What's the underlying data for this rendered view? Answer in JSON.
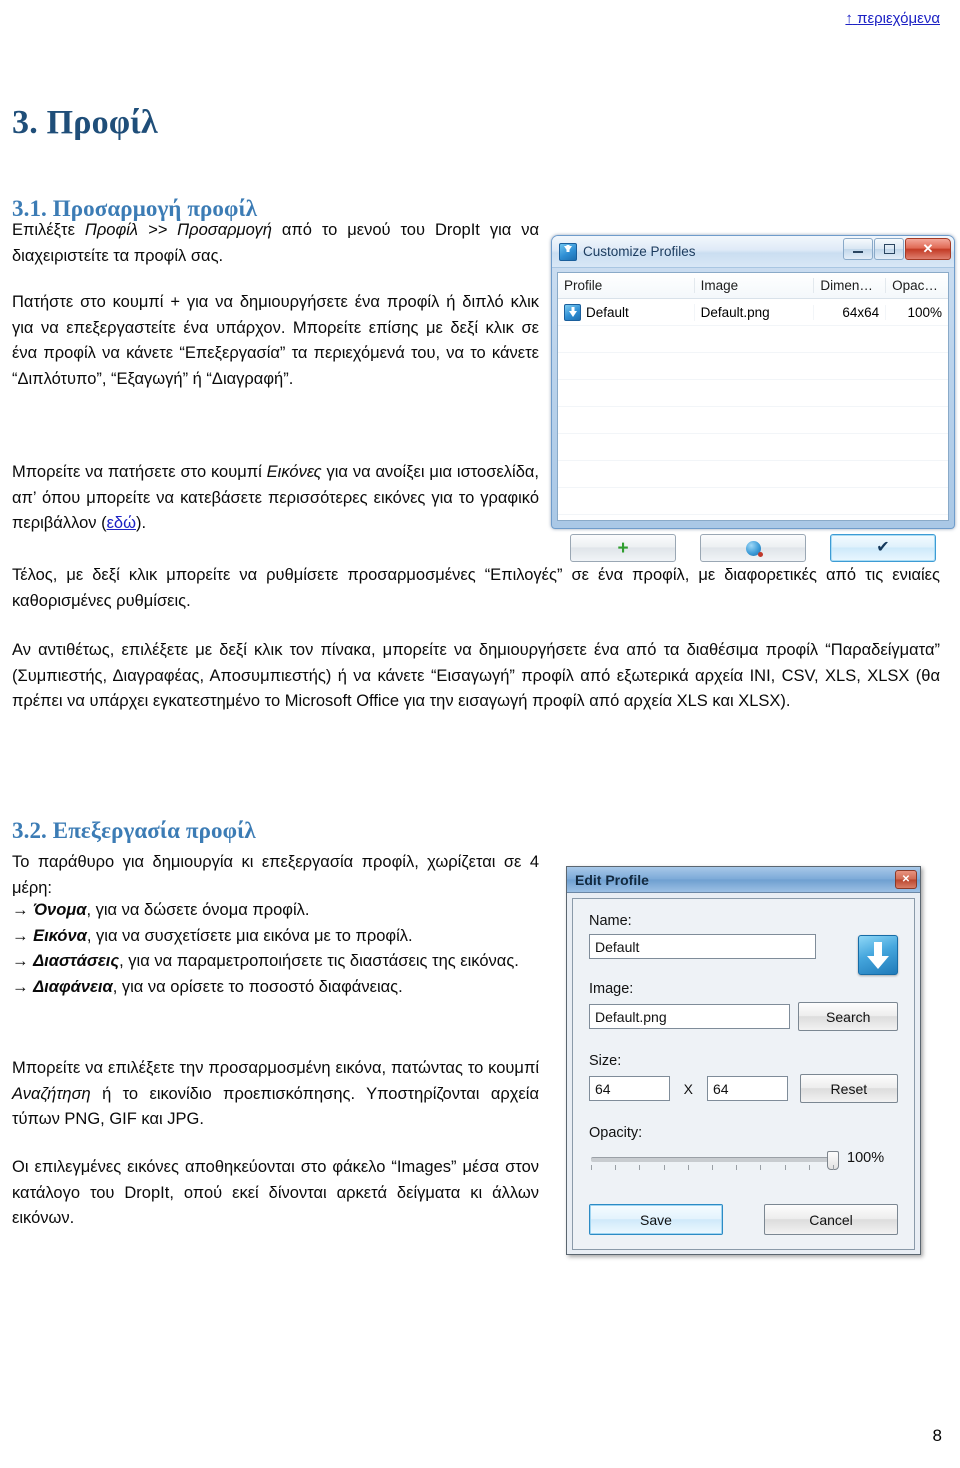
{
  "toc_link": {
    "arrow": "↑",
    "label": "περιεχόμενα"
  },
  "page_number": "8",
  "headings": {
    "h1": "3. Προφίλ",
    "h2_1": "3.1. Προσαρμογή προφίλ",
    "h2_2": "3.2. Επεξεργασία προφίλ"
  },
  "paragraphs": {
    "intro_a": "Επιλέξτε ",
    "intro_em": "Προφίλ >> Προσαρμογή",
    "intro_b": " από το μενού του DropIt για να διαχειριστείτε τα προφίλ σας.",
    "create": "Πατήστε στο κουμπί + για να δημιουργήσετε ένα προφίλ ή διπλό κλικ για να επεξεργαστείτε ένα υπάρχον. Μπορείτε επίσης με δεξί κλικ σε ένα προφίλ να κάνετε “Επεξεργασία” τα περιεχόμενά του, να το κάνετε “Διπλότυπο”, “Εξαγωγή” ή “Διαγραφή”.",
    "images_a": "Μπορείτε να πατήσετε στο κουμπί ",
    "images_em": "Εικόνες",
    "images_b": " για να ανοίξει μια ιστοσελίδα, απ’ όπου μπορείτε να κατεβάσετε περισσότερες εικόνες για το γραφικό περιβάλλον (",
    "images_link": "εδώ",
    "images_c": ").",
    "options": "Τέλος, με δεξί κλικ μπορείτε να ρυθμίσετε προσαρμοσμένες “Επιλογές” σε ένα προφίλ, με διαφορετικές από τις ενιαίες καθορισμένες ρυθμίσεις.",
    "import": "Αν αντιθέτως, επιλέξετε με δεξί κλικ τον πίνακα, μπορείτε να δημιουργήσετε ένα από τα διαθέσιμα προφίλ “Παραδείγματα” (Συμπιεστής, Διαγραφέας, Αποσυμπιεστής) ή να κάνετε “Εισαγωγή” προφίλ από εξωτερικά αρχεία INI, CSV, XLS, XLSX (θα πρέπει να υπάρχει εγκατεστημένο το Microsoft Office για την εισαγωγή προφίλ από αρχεία XLS και XLSX).",
    "edit_intro": "Το παράθυρο για δημιουργία κι επεξεργασία προφίλ, χωρίζεται σε 4 μέρη:",
    "custom_a": "Μπορείτε να επιλέξετε την προσαρμοσμένη εικόνα, πατώντας το κουμπί ",
    "custom_em": "Αναζήτηση",
    "custom_b": " ή το εικονίδιο προεπισκόπησης. Υποστηρίζονται αρχεία τύπων PNG, GIF και JPG.",
    "folder": "Οι επιλεγμένες εικόνες αποθηκεύονται στο φάκελο “Images” μέσα στον κατάλογο του DropIt, οπού εκεί δίνονται αρκετά δείγματα κι άλλων εικόνων."
  },
  "bullet_list": [
    {
      "arrow": "→",
      "term": "Όνομα",
      "rest": ", για να δώσετε όνομα προφίλ."
    },
    {
      "arrow": "→",
      "term": "Εικόνα",
      "rest": ", για να συσχετίσετε μια εικόνα με το προφίλ."
    },
    {
      "arrow": "→",
      "term": "Διαστάσεις",
      "rest": ", για να παραμετροποιήσετε τις διαστάσεις της εικόνας."
    },
    {
      "arrow": "→",
      "term": "Διαφάνεια",
      "rest": ", για να ορίσετε το ποσοστό διαφάνειας."
    }
  ],
  "customize_profiles_window": {
    "title": "Customize Profiles",
    "titlebar_buttons": {
      "minimize": "—",
      "maximize": "□",
      "close": "✕"
    },
    "columns": [
      "Profile",
      "Image",
      "Dimen…",
      "Opac…"
    ],
    "rows": [
      {
        "profile": "Default",
        "image": "Default.png",
        "dimensions": "64x64",
        "opacity": "100%"
      }
    ],
    "footer_buttons": [
      {
        "name": "add",
        "glyph": "+"
      },
      {
        "name": "images",
        "glyph": ""
      },
      {
        "name": "ok",
        "glyph": "✔"
      }
    ]
  },
  "edit_profile_window": {
    "title": "Edit Profile",
    "close_glyph": "✕",
    "fields": {
      "name_label": "Name:",
      "name_value": "Default",
      "image_label": "Image:",
      "image_value": "Default.png",
      "search_button": "Search",
      "size_label": "Size:",
      "size_width": "64",
      "size_separator": "X",
      "size_height": "64",
      "reset_button": "Reset",
      "opacity_label": "Opacity:",
      "opacity_value": "100%"
    },
    "buttons": {
      "save": "Save",
      "cancel": "Cancel"
    }
  }
}
